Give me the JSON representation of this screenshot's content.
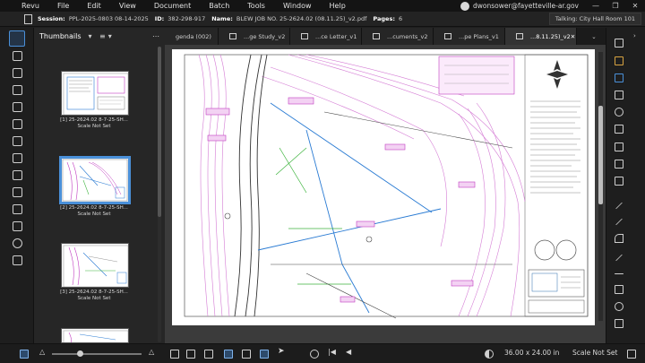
{
  "menubar": {
    "items": [
      "Revu",
      "File",
      "Edit",
      "View",
      "Document",
      "Batch",
      "Tools",
      "Window",
      "Help"
    ],
    "account": "dwonsower@fayetteville-ar.gov"
  },
  "session": {
    "session_label": "Session:",
    "session_value": "PPL-2025-0803 08-14-2025",
    "id_label": "ID:",
    "id_value": "382-298-917",
    "name_label": "Name:",
    "name_value": "BLEW JOB NO. 25-2624.02 (08.11.25)_v2.pdf",
    "pages_label": "Pages:",
    "pages_value": "6",
    "talking": "Talking: City Hall Room 101"
  },
  "thumbnails": {
    "title": "Thumbnails",
    "items": [
      {
        "caption": "[1] 25-2624.02 8-7-25-SH...",
        "scale": "Scale Not Set"
      },
      {
        "caption": "[2] 25-2624.02 8-7-25-SH...",
        "scale": "Scale Not Set"
      },
      {
        "caption": "[3] 25-2624.02 8-7-25-SH...",
        "scale": "Scale Not Set"
      }
    ]
  },
  "tabs": [
    {
      "label": "genda (002)"
    },
    {
      "label": "...ge Study_v2"
    },
    {
      "label": "...ce Letter_v1"
    },
    {
      "label": "...cuments_v2"
    },
    {
      "label": "...pe Plans_v1"
    },
    {
      "label": "...8.11.25)_v2"
    }
  ],
  "statusbar": {
    "dimensions": "36.00 x 24.00 in",
    "scale": "Scale Not Set"
  },
  "colors": {
    "accent": "#4a90d9",
    "markup": "#c03bc0",
    "contour": "#d47ad4"
  },
  "icons": [
    "grid-icon",
    "bookmark-icon",
    "layers-icon",
    "stamp-icon",
    "properties-icon",
    "markups-list-icon",
    "measure-icon",
    "search-icon",
    "print-icon",
    "pan-icon",
    "select-icon",
    "zoom-icon",
    "cloud-icon",
    "pen-icon",
    "highlight-icon",
    "line-icon",
    "arrow-icon",
    "rectangle-icon",
    "ellipse-icon",
    "polyline-icon",
    "dark-mode-icon",
    "fit-width-icon"
  ]
}
